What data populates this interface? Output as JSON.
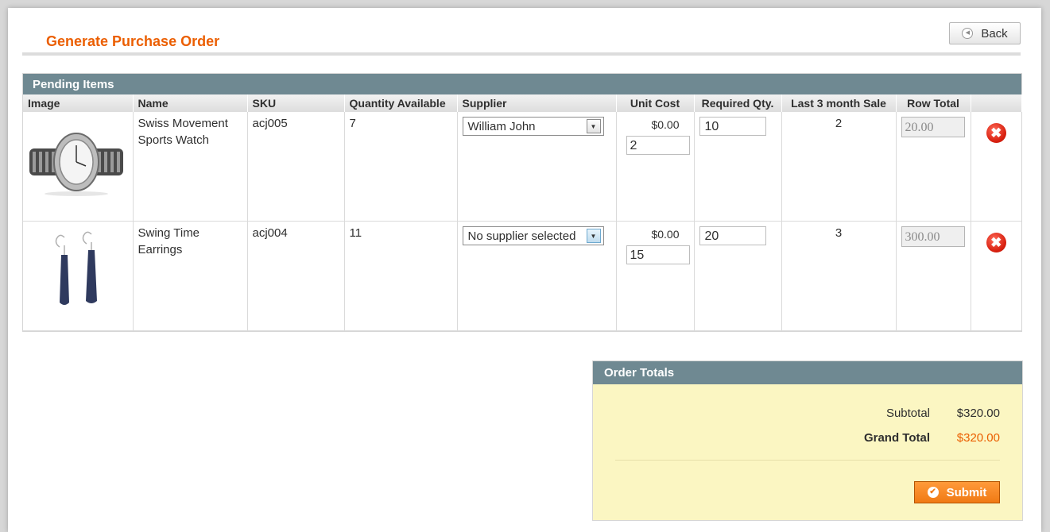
{
  "header": {
    "title": "Generate Purchase Order",
    "back_label": "Back"
  },
  "grid": {
    "title": "Pending Items",
    "columns": [
      "Image",
      "Name",
      "SKU",
      "Quantity Available",
      "Supplier",
      "Unit Cost",
      "Required Qty.",
      "Last 3 month Sale",
      "Row Total",
      ""
    ],
    "rows": [
      {
        "image_icon": "watch-image",
        "name_line1": "Swiss Movement",
        "name_line2": "Sports Watch",
        "sku": "acj005",
        "qty_available": "7",
        "supplier": "William John",
        "unit_cost_label": "$0.00",
        "unit_cost_value": "2",
        "required_qty": "10",
        "last_3_month_sale": "2",
        "row_total": "20.00"
      },
      {
        "image_icon": "earrings-image",
        "name_line1": "Swing Time",
        "name_line2": "Earrings",
        "sku": "acj004",
        "qty_available": "11",
        "supplier": "No supplier selected",
        "unit_cost_label": "$0.00",
        "unit_cost_value": "15",
        "required_qty": "20",
        "last_3_month_sale": "3",
        "row_total": "300.00"
      }
    ]
  },
  "totals": {
    "title": "Order Totals",
    "subtotal_label": "Subtotal",
    "subtotal_value": "$320.00",
    "grand_total_label": "Grand Total",
    "grand_total_value": "$320.00",
    "submit_label": "Submit"
  },
  "colors": {
    "accent": "#eb5e00",
    "section_header": "#6f8992",
    "totals_bg": "#fbf6c2",
    "delete": "#d8200f"
  }
}
